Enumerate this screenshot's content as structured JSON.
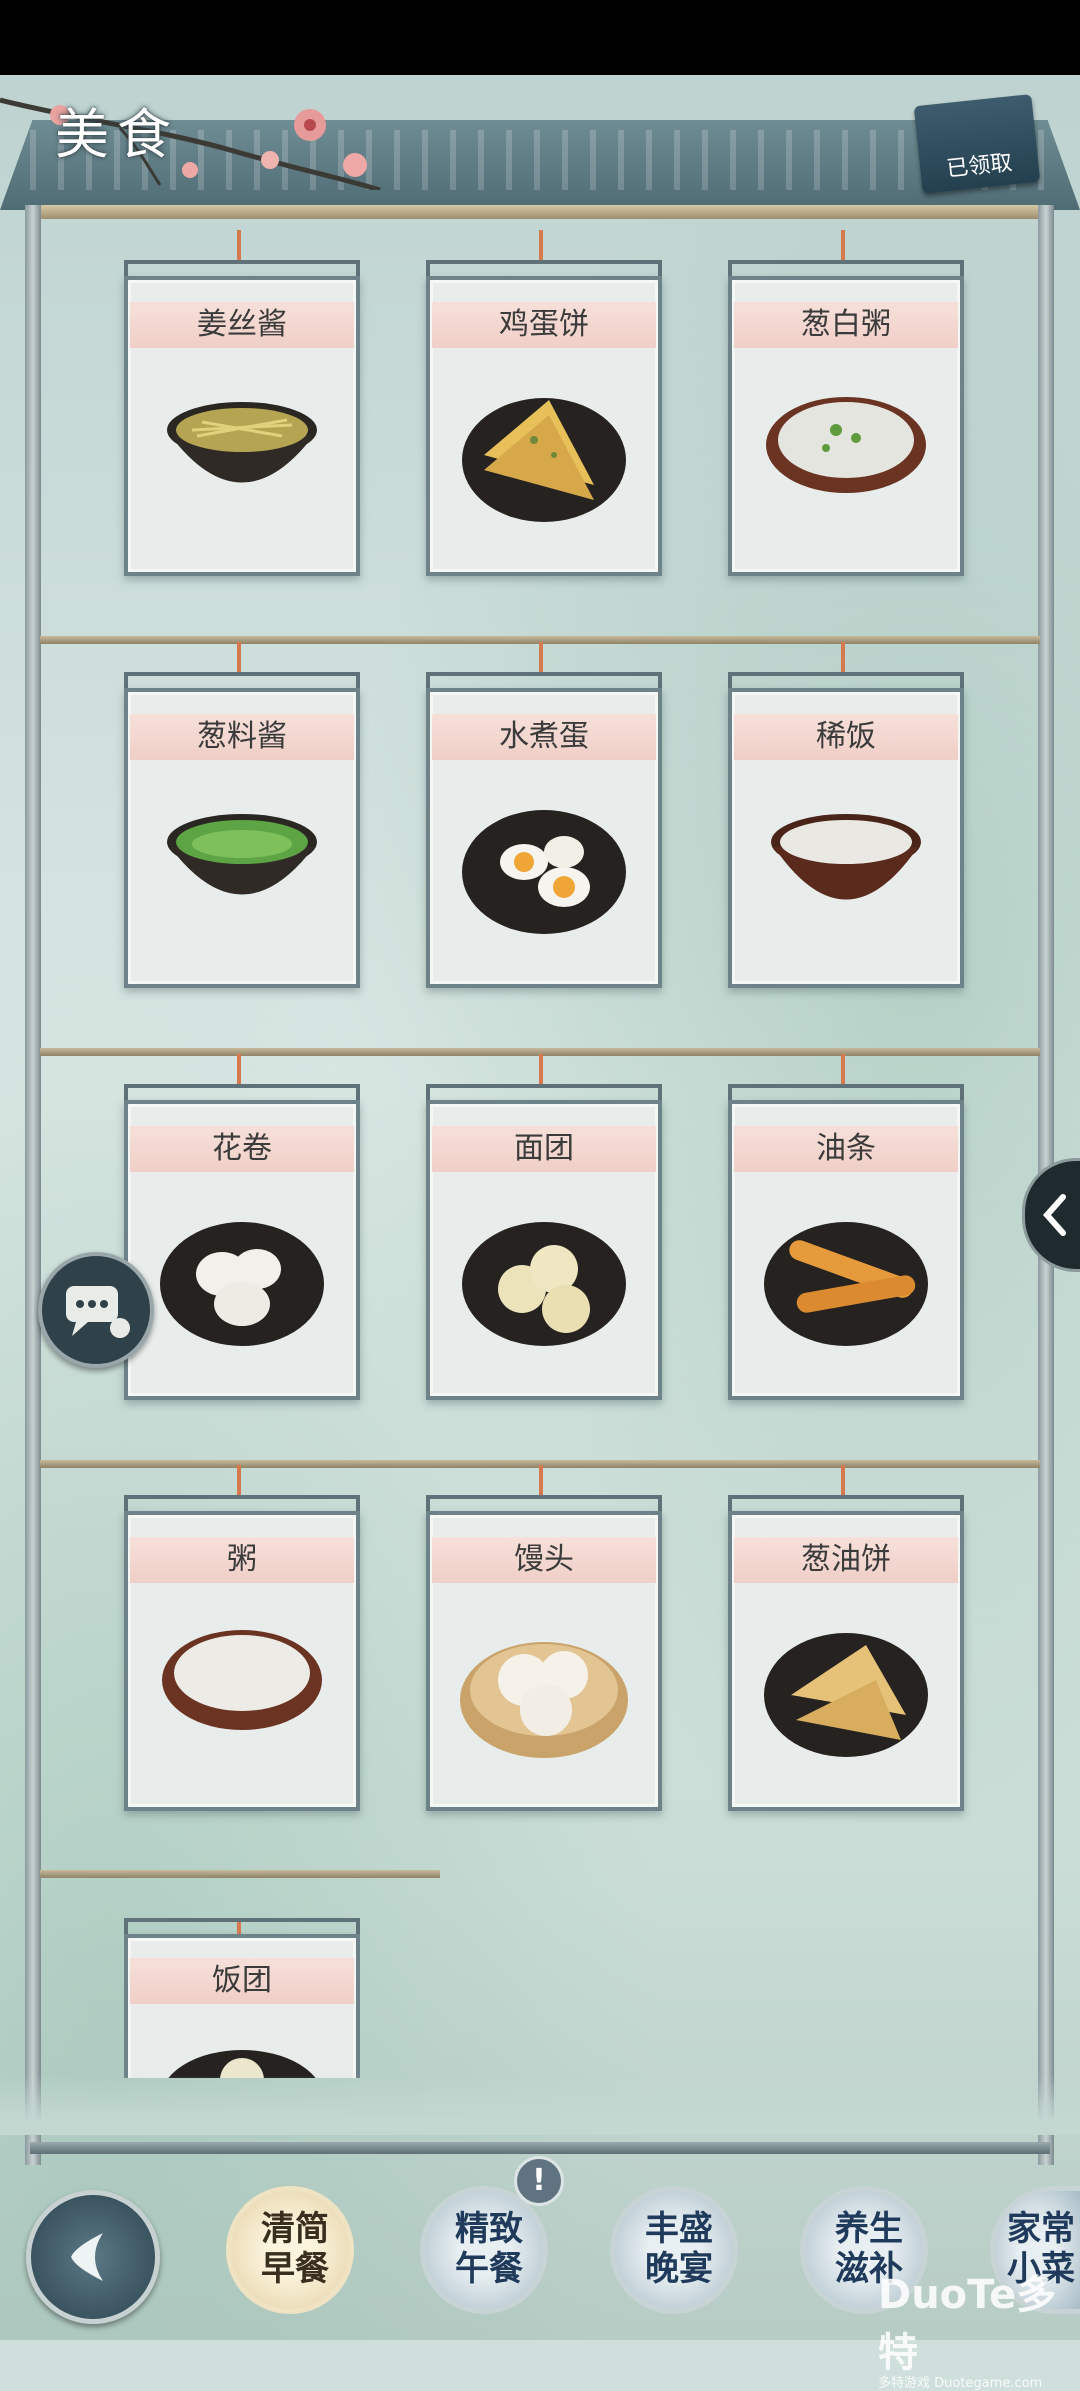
{
  "header": {
    "title": "美食",
    "claimed_label": "已领取"
  },
  "foods": [
    {
      "name": "姜丝酱",
      "icon": "ginger-sauce-icon"
    },
    {
      "name": "鸡蛋饼",
      "icon": "egg-pancake-icon"
    },
    {
      "name": "葱白粥",
      "icon": "scallion-porridge-icon"
    },
    {
      "name": "葱料酱",
      "icon": "scallion-sauce-icon"
    },
    {
      "name": "水煮蛋",
      "icon": "boiled-egg-icon"
    },
    {
      "name": "稀饭",
      "icon": "rice-porridge-icon"
    },
    {
      "name": "花卷",
      "icon": "flower-roll-icon"
    },
    {
      "name": "面团",
      "icon": "dough-ball-icon"
    },
    {
      "name": "油条",
      "icon": "fried-dough-stick-icon"
    },
    {
      "name": "粥",
      "icon": "congee-icon"
    },
    {
      "name": "馒头",
      "icon": "steamed-bun-icon"
    },
    {
      "name": "葱油饼",
      "icon": "scallion-pancake-icon"
    },
    {
      "name": "饭团",
      "icon": "rice-ball-icon"
    }
  ],
  "nav": {
    "categories": [
      {
        "label": "清简\n早餐",
        "active": true
      },
      {
        "label": "精致\n午餐",
        "active": false,
        "alert": "!"
      },
      {
        "label": "丰盛\n晚宴",
        "active": false
      },
      {
        "label": "养生\n滋补",
        "active": false
      },
      {
        "label": "家常\n小菜",
        "active": false
      }
    ]
  },
  "watermark": {
    "brand": "DuoTe多特",
    "sub": "多特游戏 Duotegame.com"
  }
}
